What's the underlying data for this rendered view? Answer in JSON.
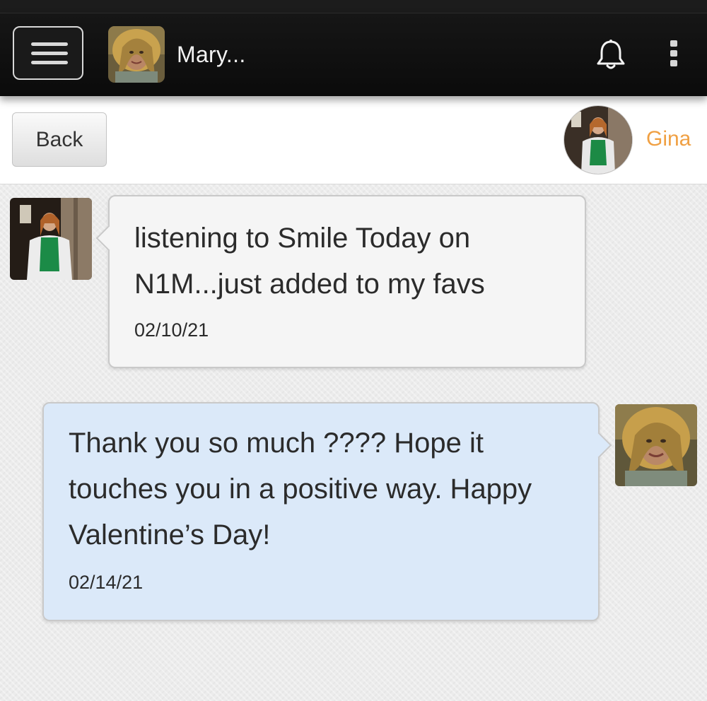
{
  "header": {
    "title": "Mary...",
    "menu_icon": "hamburger-menu-icon",
    "notifications_icon": "bell-icon",
    "more_icon": "kebab-menu-icon"
  },
  "subheader": {
    "back_label": "Back",
    "contact_name": "Gina"
  },
  "messages": [
    {
      "direction": "incoming",
      "text": "listening to Smile Today on N1M...just added to my favs",
      "date": "02/10/21"
    },
    {
      "direction": "outgoing",
      "text": "Thank you so much ???? Hope it touches you in a positive way. Happy Valentine’s Day!",
      "date": "02/14/21"
    }
  ],
  "colors": {
    "topbar": "#0e0e0e",
    "contact_name": "#f0a043",
    "incoming_bubble": "#f5f5f5",
    "outgoing_bubble": "#dbe9f9"
  }
}
